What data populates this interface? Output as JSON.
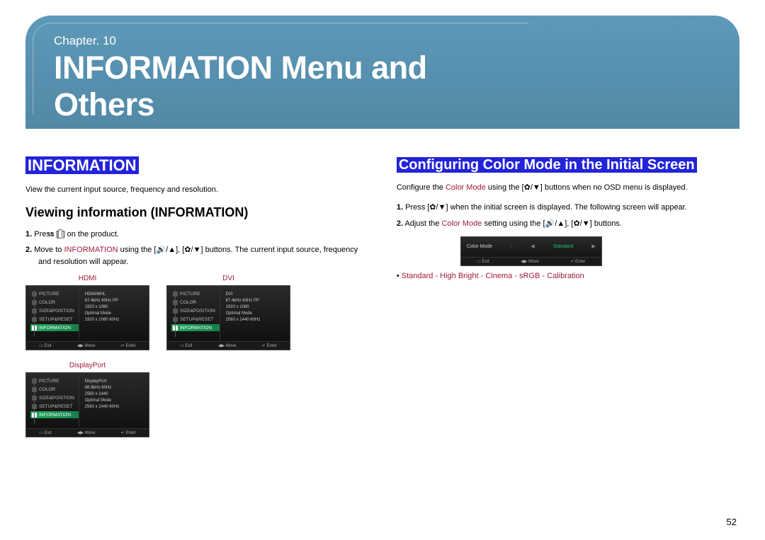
{
  "chapter": {
    "label": "Chapter. 10",
    "title": "INFORMATION Menu and Others"
  },
  "left": {
    "heading": "INFORMATION",
    "intro": "View the current input source, frequency and resolution.",
    "subhead": "Viewing information (INFORMATION)",
    "step1_prefix": "1.",
    "step1_a": "Press [",
    "step1_btn": "▭",
    "step1_b": "] on the product.",
    "step2_prefix": "2.",
    "step2_a": "Move to ",
    "step2_hl": "INFORMATION",
    "step2_b": " using the [🔊/▲], [✿/▼] buttons. The current input source, frequency and resolution will appear.",
    "osd_menu_items": [
      "PICTURE",
      "COLOR",
      "SIZE&POSITION",
      "SETUP&RESET",
      "INFORMATION"
    ],
    "footer_exit": "Exit",
    "footer_move": "Move",
    "footer_enter": "Enter",
    "hdmi": {
      "label": "HDMI",
      "lines": [
        "HDMI/MHL",
        "67.4kHz  60Hz  PP",
        "1920 x 1080",
        "",
        "Optimal Mode",
        "1920 x 1080  60Hz"
      ]
    },
    "dvi": {
      "label": "DVI",
      "lines": [
        "DVI",
        "67.4kHz  60Hz  PP",
        "1920 x 1080",
        "",
        "Optimal Mode",
        "2560 x 1440  60Hz"
      ]
    },
    "dp": {
      "label": "DisplayPort",
      "lines": [
        "DisplayPort",
        "88.9kHz  60Hz",
        "2560 x 1440",
        "",
        "Optimal Mode",
        "2560 x 1440  60Hz"
      ]
    }
  },
  "right": {
    "heading": "Configuring Color Mode in the Initial Screen",
    "intro_a": "Configure the ",
    "intro_hl": "Color Mode",
    "intro_b": " using the [✿/▼] buttons when no OSD menu is displayed.",
    "step1_prefix": "1.",
    "step1": "Press [✿/▼] when the initial screen is displayed. The following screen will appear.",
    "step2_prefix": "2.",
    "step2_a": "Adjust the ",
    "step2_hl": "Color Mode",
    "step2_b": " setting using the [🔊/▲], [✿/▼] buttons.",
    "color_osd": {
      "label": "Color Mode",
      "value": "Standard"
    },
    "modes_bullet": "• ",
    "modes": "Standard - High Bright - Cinema - sRGB - Calibration"
  },
  "page_number": "52"
}
